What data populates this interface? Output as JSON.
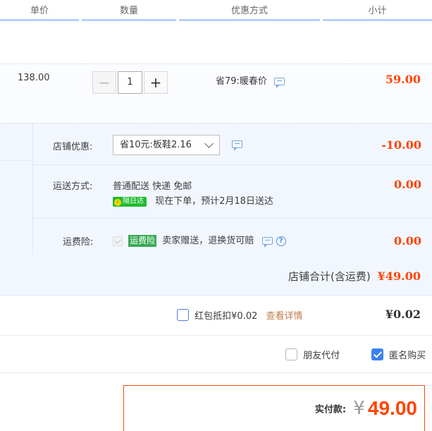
{
  "header": {
    "col_price": "单价",
    "col_qty": "数量",
    "col_promo": "优惠方式",
    "col_subtotal": "小计"
  },
  "item": {
    "price": "138.00",
    "qty_minus": "−",
    "qty_value": "1",
    "qty_plus": "+",
    "promo": "省79:暖春价",
    "subtotal": "59.00"
  },
  "shop": {
    "discount_label": "店铺优惠:",
    "discount_selected": "省10元:板鞋2.16",
    "discount_value": "-10.00",
    "shipping_label": "运送方式:",
    "shipping_method": "普通配送 快递 免邮",
    "shipping_badge": "隔日达",
    "shipping_eta": "现在下单，预计2月18日送达",
    "shipping_value": "0.00",
    "insurance_label": "运费险:",
    "insurance_tag": "运费险",
    "insurance_desc": "卖家赠送，退换货可赔",
    "insurance_help": "?",
    "insurance_value": "0.00",
    "total_label": "店铺合计(含运费)",
    "total_value": "¥49.00"
  },
  "redpacket": {
    "label": "红包抵扣¥0.02",
    "link": "查看详情",
    "value": "¥0.02"
  },
  "options": {
    "friend_pay": "朋友代付",
    "anonymous": "匿名购买"
  },
  "payment": {
    "label": "实付款:",
    "currency": "¥",
    "amount": "49.00"
  },
  "colors": {
    "accent_red": "#ff4400",
    "header_underline": "#b2d1ff",
    "shop_bg": "#f2f7ff",
    "badge_green": "#1ebc2e",
    "checkbox_blue": "#3b82f0",
    "link_orange": "#c07b4a"
  },
  "icons": [
    "chat-icon",
    "chevron-down-icon",
    "bolt-icon",
    "question-icon",
    "check-icon"
  ]
}
